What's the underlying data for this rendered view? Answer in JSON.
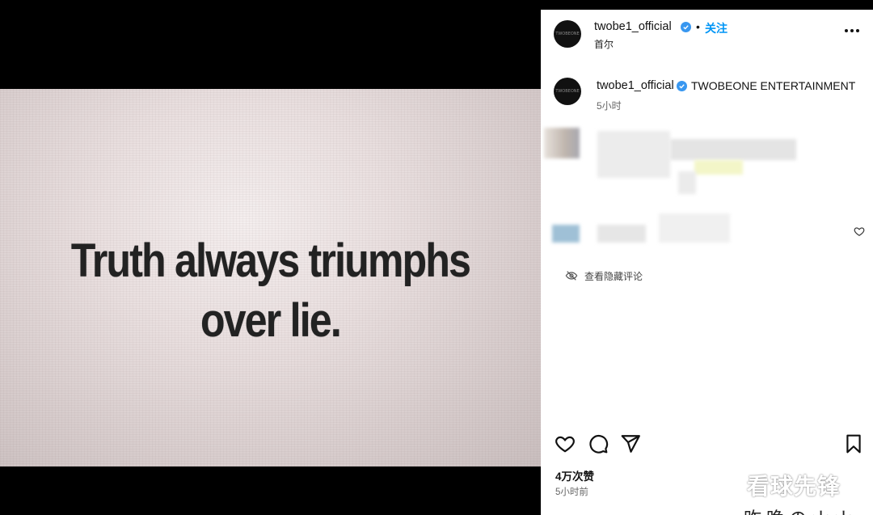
{
  "poster": {
    "line1": "Truth always triumphs",
    "line2": "over lie."
  },
  "header": {
    "username": "twobe1_official",
    "separator": "•",
    "follow_label": "关注",
    "location": "首尔",
    "avatar_text": "TWOBEONE"
  },
  "caption": {
    "username": "twobe1_official",
    "text": "TWOBEONE ENTERTAINMENT",
    "time": "5小时"
  },
  "comments": {
    "hidden_label": "查看隐藏评论"
  },
  "footer": {
    "likes": "4万次赞",
    "time": "5小时前"
  },
  "watermark": "看球先锋",
  "bottom_partial_text": "昨晚のナナ",
  "colors": {
    "verified": "#3897f0",
    "follow": "#0095f6"
  },
  "icons": [
    "verified-icon",
    "more-icon",
    "heart-icon",
    "comment-icon",
    "share-icon",
    "bookmark-icon",
    "eye-off-icon"
  ]
}
